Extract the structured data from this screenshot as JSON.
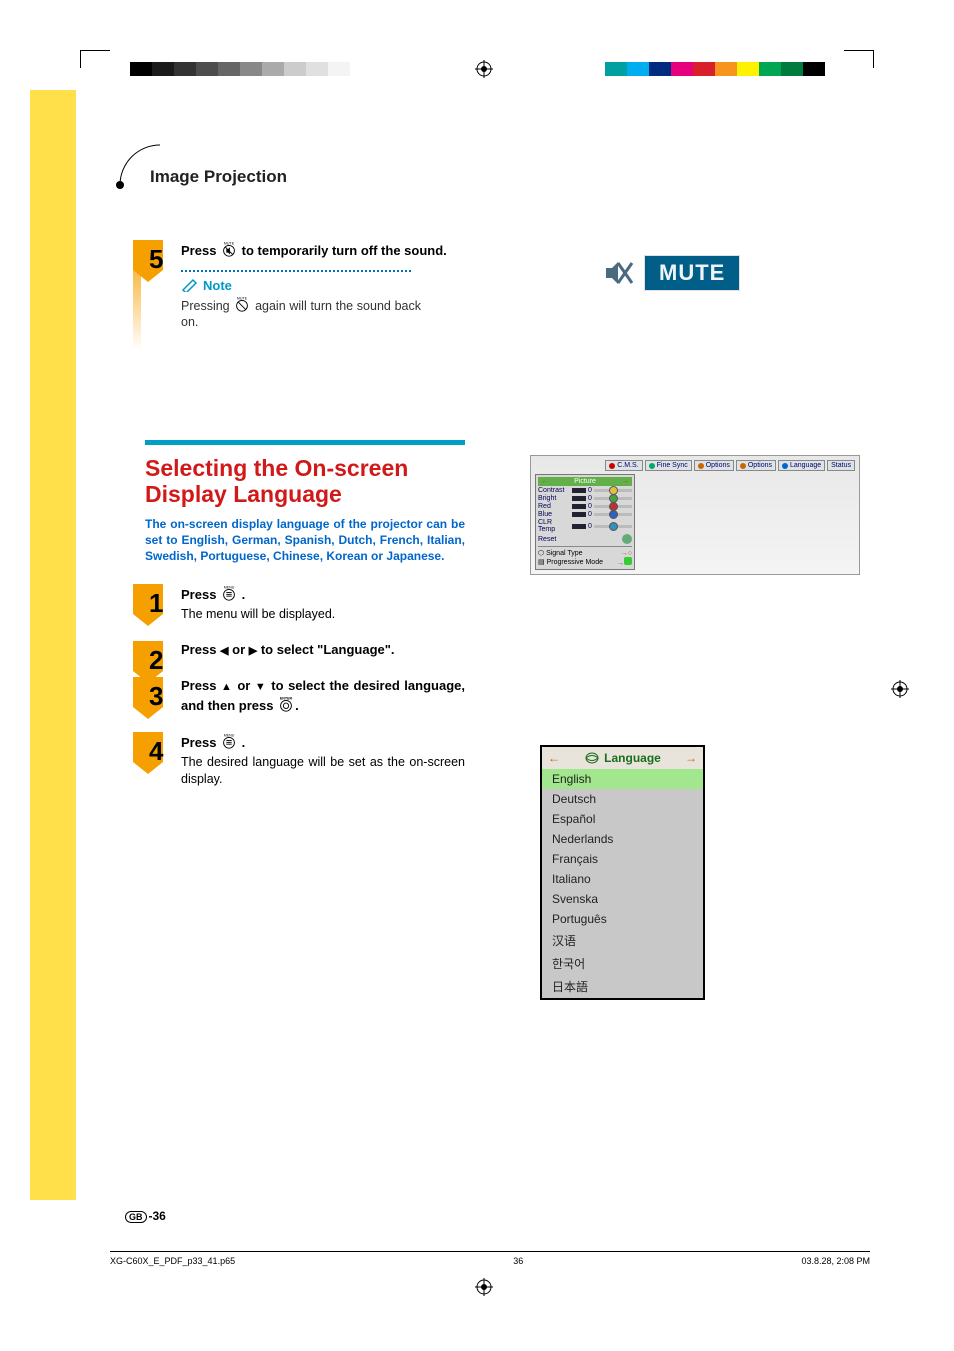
{
  "header": {
    "title": "Image Projection"
  },
  "step5": {
    "num": "5",
    "text_a": "Press ",
    "text_b": " to temporarily turn off the sound.",
    "note_label": "Note",
    "note_a": "Pressing ",
    "note_b": " again will turn the sound back on.",
    "mute_icon_label": "MUTE"
  },
  "section": {
    "heading": "Selecting the On-screen Display Language",
    "intro": "The on-screen display language of the projector can be set to English, German, Spanish, Dutch, French, Italian, Swedish, Portuguese, Chinese, Korean or Japanese."
  },
  "step1": {
    "num": "1",
    "text_a": "Press ",
    "text_b": ".",
    "sub": "The menu will be displayed.",
    "menu_icon_label": "MENU"
  },
  "step2": {
    "num": "2",
    "text_a": "Press ",
    "text_mid": " or ",
    "text_b": " to select \"Language\"."
  },
  "step3": {
    "num": "3",
    "text_a": "Press ",
    "text_mid": " or ",
    "text_b": " to select the desired language, and then press ",
    "text_c": ".",
    "enter_icon_label": "ENTER"
  },
  "step4": {
    "num": "4",
    "text_a": "Press ",
    "text_b": ".",
    "sub": "The desired language will be set as the on-screen display.",
    "menu_icon_label": "MENU"
  },
  "mute_osd": {
    "label": "MUTE"
  },
  "menu_shot": {
    "tabs": [
      "C.M.S.",
      "Fine Sync",
      "Options",
      "Options",
      "Language",
      "Status"
    ],
    "panel_title": "Picture",
    "rows": [
      {
        "label": "Contrast",
        "knob": "#e0c040"
      },
      {
        "label": "Bright",
        "knob": "#4aa040"
      },
      {
        "label": "Red",
        "knob": "#c03030"
      },
      {
        "label": "Blue",
        "knob": "#3060c0"
      },
      {
        "label": "CLR Temp",
        "knob": "#3090c0"
      }
    ],
    "reset": "Reset",
    "signal_type": "Signal Type",
    "progressive": "Progressive Mode"
  },
  "language_panel": {
    "title": "Language",
    "items": [
      "English",
      "Deutsch",
      "Español",
      "Nederlands",
      "Français",
      "Italiano",
      "Svenska",
      "Português",
      "汉语",
      "한국어",
      "日本語"
    ],
    "selected": "English"
  },
  "page": {
    "gb": "GB",
    "num": "-36"
  },
  "footer": {
    "file": "XG-C60X_E_PDF_p33_41.p65",
    "page": "36",
    "date": "03.8.28, 2:08 PM"
  }
}
